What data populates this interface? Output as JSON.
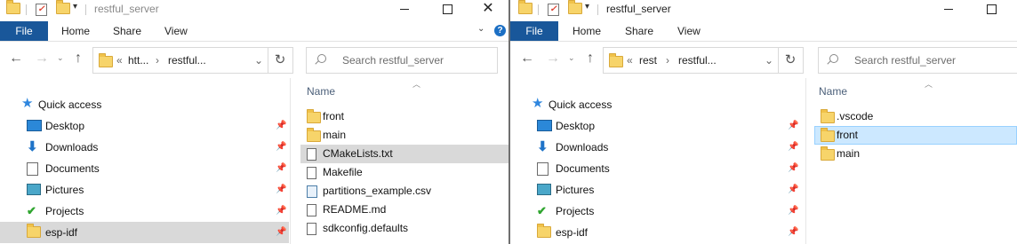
{
  "left": {
    "title": "restful_server",
    "tabs": [
      "File",
      "Home",
      "Share",
      "View"
    ],
    "addr": [
      "htt...",
      "restful..."
    ],
    "addr_prefix": "«",
    "search_placeholder": "Search restful_server",
    "column_header": "Name",
    "nav": [
      {
        "label": "Quick access",
        "icon": "star-icon"
      },
      {
        "label": "Desktop",
        "icon": "desktop-icon",
        "pinned": true
      },
      {
        "label": "Downloads",
        "icon": "download-icon",
        "pinned": true
      },
      {
        "label": "Documents",
        "icon": "documents-icon",
        "pinned": true
      },
      {
        "label": "Pictures",
        "icon": "pictures-icon",
        "pinned": true
      },
      {
        "label": "Projects",
        "icon": "projects-icon",
        "pinned": true
      },
      {
        "label": "esp-idf",
        "icon": "folder-icon",
        "pinned": true
      }
    ],
    "files": [
      {
        "name": "front",
        "type": "folder"
      },
      {
        "name": "main",
        "type": "folder"
      },
      {
        "name": "CMakeLists.txt",
        "type": "file"
      },
      {
        "name": "Makefile",
        "type": "file"
      },
      {
        "name": "partitions_example.csv",
        "type": "csv"
      },
      {
        "name": "README.md",
        "type": "file"
      },
      {
        "name": "sdkconfig.defaults",
        "type": "file"
      }
    ]
  },
  "right": {
    "title": "restful_server",
    "tabs": [
      "File",
      "Home",
      "Share",
      "View"
    ],
    "addr": [
      "rest",
      "restful..."
    ],
    "addr_prefix": "«",
    "search_placeholder": "Search restful_server",
    "column_header": "Name",
    "nav": [
      {
        "label": "Quick access",
        "icon": "star-icon"
      },
      {
        "label": "Desktop",
        "icon": "desktop-icon",
        "pinned": true
      },
      {
        "label": "Downloads",
        "icon": "download-icon",
        "pinned": true
      },
      {
        "label": "Documents",
        "icon": "documents-icon",
        "pinned": true
      },
      {
        "label": "Pictures",
        "icon": "pictures-icon",
        "pinned": true
      },
      {
        "label": "Projects",
        "icon": "projects-icon",
        "pinned": true
      },
      {
        "label": "esp-idf",
        "icon": "folder-icon",
        "pinned": true
      }
    ],
    "files": [
      {
        "name": ".vscode",
        "type": "folder"
      },
      {
        "name": "front",
        "type": "folder"
      },
      {
        "name": "main",
        "type": "folder"
      }
    ]
  },
  "colors": {
    "file_tab": "#19579a",
    "selection": "#cce8ff",
    "hover": "#d9d9d9"
  }
}
